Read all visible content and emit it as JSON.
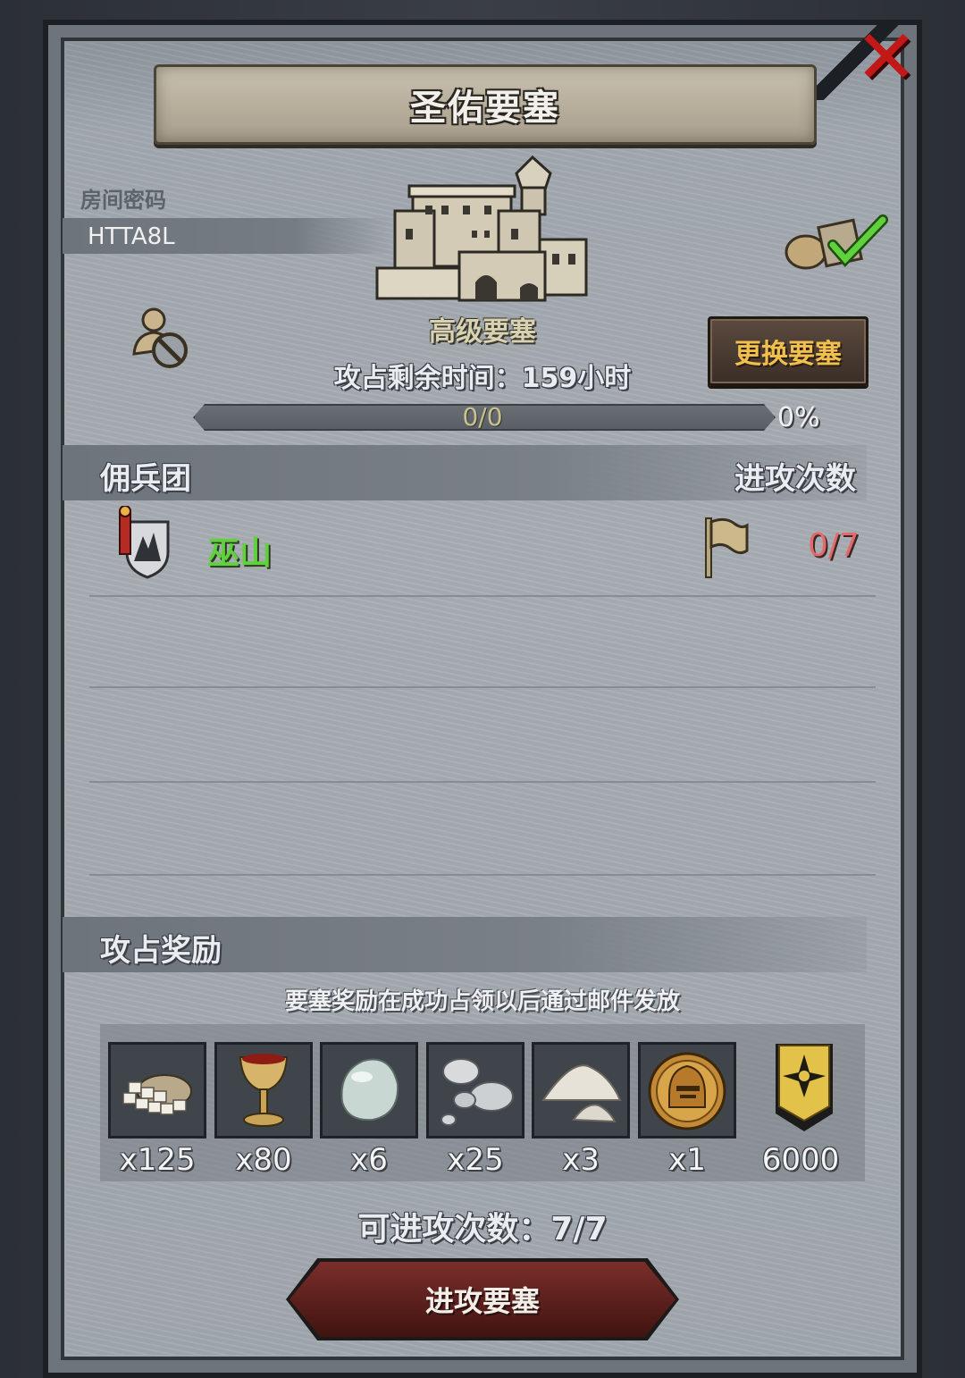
{
  "header": {
    "title": "圣佑要塞"
  },
  "room": {
    "label": "房间密码",
    "code": "HTTA8L"
  },
  "fortress": {
    "level": "高级要塞",
    "time_left": "攻占剩余时间：159小时",
    "progress_text": "0/0",
    "progress_percent": "0%",
    "progress_fraction": 0,
    "change_button": "更换要塞"
  },
  "mercenary": {
    "title": "佣兵团",
    "attacks_header": "进攻次数",
    "guilds": [
      {
        "name": "巫山",
        "attacks": "0/7"
      }
    ]
  },
  "rewards": {
    "title": "攻占奖励",
    "note": "要塞奖励在成功占领以后通过邮件发放",
    "items": [
      {
        "icon": "stone-blocks-icon",
        "qty": "x125"
      },
      {
        "icon": "goblet-icon",
        "qty": "x80"
      },
      {
        "icon": "gem-stone-icon",
        "qty": "x6"
      },
      {
        "icon": "silver-pearls-icon",
        "qty": "x25"
      },
      {
        "icon": "powder-icon",
        "qty": "x3"
      },
      {
        "icon": "helmet-coin-icon",
        "qty": "x1"
      },
      {
        "icon": "honor-badge-icon",
        "qty": "6000"
      }
    ]
  },
  "footer": {
    "attacks_left": "可进攻次数：7/7",
    "attack_button": "进攻要塞"
  },
  "colors": {
    "guild_name": "#5fd23b",
    "attacks_count": "#e26a6a",
    "change_button_text": "#f0bf4e",
    "close_x": "#c21818"
  }
}
